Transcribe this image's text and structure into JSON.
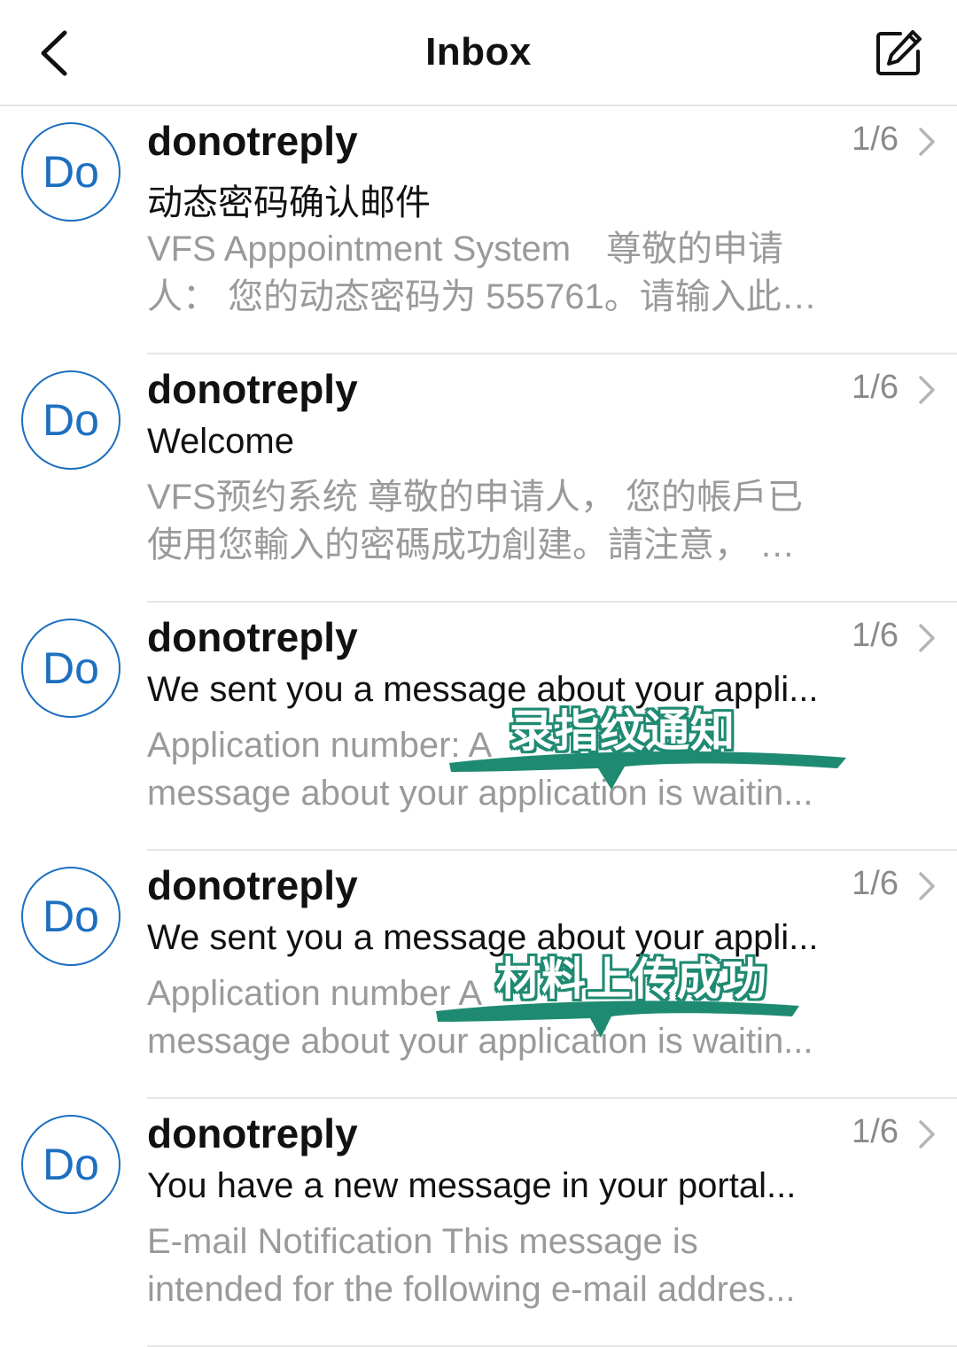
{
  "header": {
    "title": "Inbox"
  },
  "icons": {
    "back": "chevron-left-icon",
    "compose": "compose-icon",
    "row_chevron": "chevron-right-icon"
  },
  "colors": {
    "accent": "#1d6fc0",
    "sticker": "#1f8a72",
    "muted": "#9a9a9a"
  },
  "messages": [
    {
      "avatar": "Do",
      "sender": "donotreply",
      "count": "1/6",
      "subject": "动态密码确认邮件",
      "preview": "VFS Apppointment System　尊敬的申请\n人：  您的动态密码为 555761。请输入此…",
      "sticker": ""
    },
    {
      "avatar": "Do",
      "sender": "donotreply",
      "count": "1/6",
      "subject": "Welcome",
      "preview": "VFS预约系统 尊敬的申请人，  您的帳戶已\n使用您輸入的密碼成功創建。請注意，  …",
      "sticker": ""
    },
    {
      "avatar": "Do",
      "sender": "donotreply",
      "count": "1/6",
      "subject": "We sent you a message about your appli...",
      "preview": "Application number: A\nmessage about your application is waitin...",
      "sticker": "录指纹通知"
    },
    {
      "avatar": "Do",
      "sender": "donotreply",
      "count": "1/6",
      "subject": "We sent you a message about your appli...",
      "preview": "Application number A\nmessage about your application is waitin...",
      "sticker": "材料上传成功"
    },
    {
      "avatar": "Do",
      "sender": "donotreply",
      "count": "1/6",
      "subject": "You have a new message in your portal...",
      "preview": "E-mail Notification This message is\nintended for the following e-mail addres...",
      "sticker": ""
    }
  ]
}
